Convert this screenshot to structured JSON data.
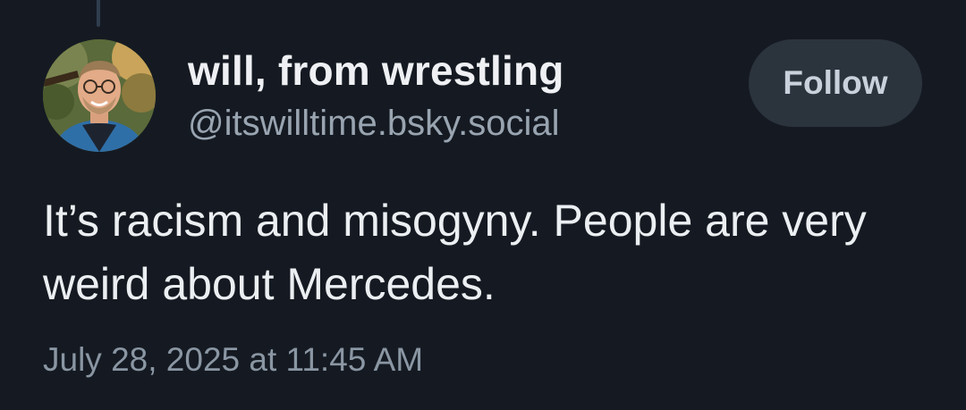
{
  "author": {
    "display_name": "will, from wrestling",
    "handle": "@itswilltime.bsky.social"
  },
  "follow_button": {
    "label": "Follow"
  },
  "post": {
    "text": "It’s racism and misogyny. People are very weird about Mercedes.",
    "timestamp": "July 28, 2025 at 11:45 AM"
  },
  "colors": {
    "background": "#151a22",
    "primary_text": "#eceff2",
    "secondary_text": "#99a4b1",
    "button_bg": "#2b333d",
    "button_text": "#c9d2dc"
  }
}
